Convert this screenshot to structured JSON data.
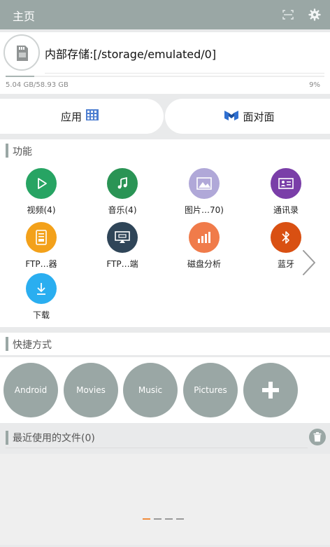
{
  "titlebar": {
    "title": "主页",
    "icons": [
      "scan-icon",
      "gear-icon"
    ]
  },
  "storage": {
    "icon": "sd-card-icon",
    "path": "内部存储:[/storage/emulated/0]",
    "used": "5.04 GB/58.93 GB",
    "percent_label": "9%",
    "percent_value": 9
  },
  "buttons": {
    "apps": "应用",
    "apps_icon": "grid-icon",
    "face2face": "面对面",
    "face2face_icon": "face-to-face-icon"
  },
  "functions": {
    "title": "功能",
    "items": [
      {
        "label": "视频(4)",
        "icon": "play-icon",
        "color": "#27a463"
      },
      {
        "label": "音乐(4)",
        "icon": "music-note-icon",
        "color": "#2a9455"
      },
      {
        "label": "图片…70)",
        "icon": "image-icon",
        "color": "#b0a8d8"
      },
      {
        "label": "通讯录",
        "icon": "contact-card-icon",
        "color": "#7a3ea8"
      },
      {
        "label": "FTP…器",
        "icon": "ftp-server-icon",
        "color": "#f3a11a"
      },
      {
        "label": "FTP…端",
        "icon": "ftp-client-icon",
        "color": "#2f4558"
      },
      {
        "label": "磁盘分析",
        "icon": "bar-chart-icon",
        "color": "#f07b4a"
      },
      {
        "label": "蓝牙",
        "icon": "bluetooth-icon",
        "color": "#d95012"
      },
      {
        "label": "下载",
        "icon": "download-icon",
        "color": "#2aaef0"
      }
    ]
  },
  "shortcuts": {
    "title": "快捷方式",
    "items": [
      "Android",
      "Movies",
      "Music",
      "Pictures"
    ],
    "add_icon": "plus-icon"
  },
  "recent": {
    "title": "最近使用的文件(0)",
    "trash_icon": "trash-icon"
  },
  "colors": {
    "accent": "#9aa7a5",
    "pager_active": "#f08c3c"
  }
}
